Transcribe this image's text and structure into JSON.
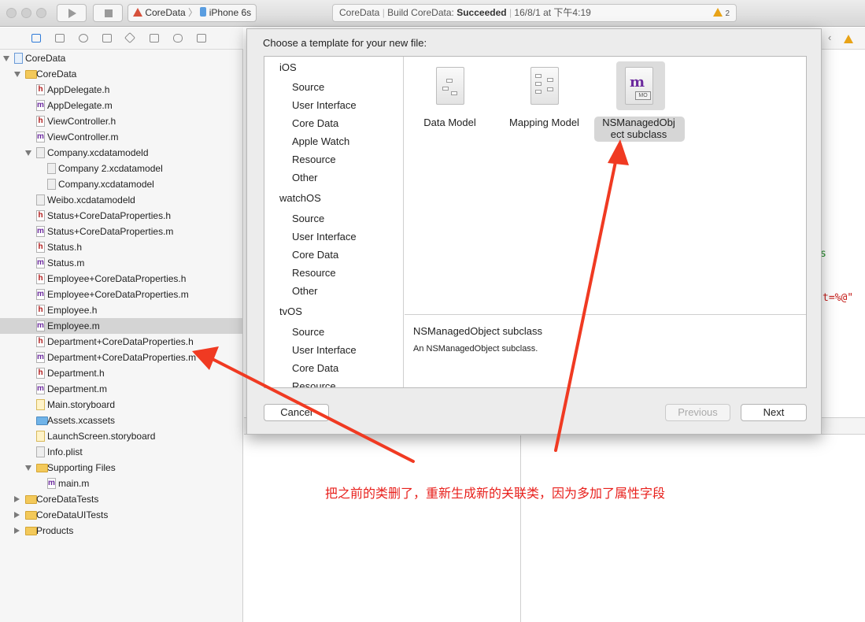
{
  "toolbar": {
    "scheme_project": "CoreData",
    "scheme_device": "iPhone 6s",
    "status_project": "CoreData",
    "status_prefix": "Build CoreData:",
    "status_result": "Succeeded",
    "status_time": "16/8/1 at 下午4:19",
    "warning_count": "2"
  },
  "navigator": {
    "rows": [
      {
        "label": "CoreData",
        "indent": 0,
        "disclosure": "open",
        "icon": "project-icon"
      },
      {
        "label": "CoreData",
        "indent": 1,
        "disclosure": "open",
        "icon": "folder-icon"
      },
      {
        "label": "AppDelegate.h",
        "indent": 2,
        "icon": "h-file-icon"
      },
      {
        "label": "AppDelegate.m",
        "indent": 2,
        "icon": "m-file-icon"
      },
      {
        "label": "ViewController.h",
        "indent": 2,
        "icon": "h-file-icon"
      },
      {
        "label": "ViewController.m",
        "indent": 2,
        "icon": "m-file-icon"
      },
      {
        "label": "Company.xcdatamodeld",
        "indent": 2,
        "disclosure": "open",
        "icon": "datamodel-icon"
      },
      {
        "label": "Company 2.xcdatamodel",
        "indent": 3,
        "icon": "datamodel-current-icon"
      },
      {
        "label": "Company.xcdatamodel",
        "indent": 3,
        "icon": "datamodel-icon"
      },
      {
        "label": "Weibo.xcdatamodeld",
        "indent": 2,
        "icon": "datamodel-icon"
      },
      {
        "label": "Status+CoreDataProperties.h",
        "indent": 2,
        "icon": "h-file-icon"
      },
      {
        "label": "Status+CoreDataProperties.m",
        "indent": 2,
        "icon": "m-file-icon"
      },
      {
        "label": "Status.h",
        "indent": 2,
        "icon": "h-file-icon"
      },
      {
        "label": "Status.m",
        "indent": 2,
        "icon": "m-file-icon"
      },
      {
        "label": "Employee+CoreDataProperties.h",
        "indent": 2,
        "icon": "h-file-icon"
      },
      {
        "label": "Employee+CoreDataProperties.m",
        "indent": 2,
        "icon": "m-file-icon"
      },
      {
        "label": "Employee.h",
        "indent": 2,
        "icon": "h-file-icon"
      },
      {
        "label": "Employee.m",
        "indent": 2,
        "icon": "m-file-icon",
        "selected": true
      },
      {
        "label": "Department+CoreDataProperties.h",
        "indent": 2,
        "icon": "h-file-icon"
      },
      {
        "label": "Department+CoreDataProperties.m",
        "indent": 2,
        "icon": "m-file-icon"
      },
      {
        "label": "Department.h",
        "indent": 2,
        "icon": "h-file-icon"
      },
      {
        "label": "Department.m",
        "indent": 2,
        "icon": "m-file-icon"
      },
      {
        "label": "Main.storyboard",
        "indent": 2,
        "icon": "storyboard-icon"
      },
      {
        "label": "Assets.xcassets",
        "indent": 2,
        "icon": "assets-folder-icon"
      },
      {
        "label": "LaunchScreen.storyboard",
        "indent": 2,
        "icon": "storyboard-icon"
      },
      {
        "label": "Info.plist",
        "indent": 2,
        "icon": "plist-icon"
      },
      {
        "label": "Supporting Files",
        "indent": 2,
        "disclosure": "open",
        "icon": "folder-icon"
      },
      {
        "label": "main.m",
        "indent": 3,
        "icon": "m-file-icon"
      },
      {
        "label": "CoreDataTests",
        "indent": 1,
        "disclosure": "closed",
        "icon": "folder-icon"
      },
      {
        "label": "CoreDataUITests",
        "indent": 1,
        "disclosure": "closed",
        "icon": "folder-icon"
      },
      {
        "label": "Products",
        "indent": 1,
        "disclosure": "closed",
        "icon": "folder-icon"
      }
    ]
  },
  "editor": {
    "fragment1": "s",
    "fragment2": "t=%@\""
  },
  "sheet": {
    "title": "Choose a template for your new file:",
    "platforms": [
      {
        "label": "iOS",
        "kind": "header"
      },
      {
        "label": "Source",
        "kind": "item"
      },
      {
        "label": "User Interface",
        "kind": "item"
      },
      {
        "label": "Core Data",
        "kind": "item"
      },
      {
        "label": "Apple Watch",
        "kind": "item"
      },
      {
        "label": "Resource",
        "kind": "item"
      },
      {
        "label": "Other",
        "kind": "item"
      },
      {
        "label": "watchOS",
        "kind": "header"
      },
      {
        "label": "Source",
        "kind": "item"
      },
      {
        "label": "User Interface",
        "kind": "item"
      },
      {
        "label": "Core Data",
        "kind": "item"
      },
      {
        "label": "Resource",
        "kind": "item"
      },
      {
        "label": "Other",
        "kind": "item"
      },
      {
        "label": "tvOS",
        "kind": "header"
      },
      {
        "label": "Source",
        "kind": "item"
      },
      {
        "label": "User Interface",
        "kind": "item"
      },
      {
        "label": "Core Data",
        "kind": "item"
      },
      {
        "label": "Resource",
        "kind": "item"
      }
    ],
    "templates": [
      {
        "label_line1": "Data Model",
        "label_line2": ""
      },
      {
        "label_line1": "Mapping Model",
        "label_line2": ""
      },
      {
        "label_line1": "NSManagedObj",
        "label_line2": "ect subclass",
        "icon_text": "m",
        "icon_tag": "MO"
      }
    ],
    "description_title": "NSManagedObject subclass",
    "description_text": "An NSManagedObject subclass.",
    "cancel_label": "Cancel",
    "previous_label": "Previous",
    "next_label": "Next"
  },
  "annotation": {
    "text": "把之前的类删了，重新生成新的关联类，因为多加了属性字段",
    "color": "#e8201c"
  }
}
